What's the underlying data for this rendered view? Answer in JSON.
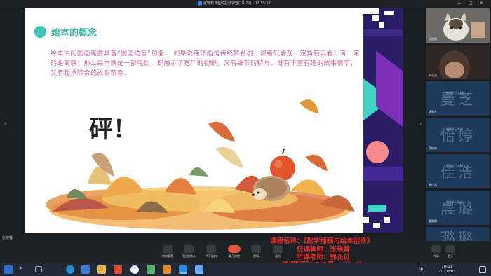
{
  "window": {
    "title": "张晓霄发起的在线课堂(18/22) | 02:19:28"
  },
  "slide": {
    "title": "绘本的概念",
    "body": "绘本中的图画需要具备“图画语言”功能， 如果说连环画是传统舞台剧，读者只能在一定角度去看，有一定的距离感；那么绘本就是一部电影，即展示了宽广的视野，又有细节的特写，既有丰富有趣的故事情节，又有起承转合的故事节奏。",
    "onomatopoeia": "砰！"
  },
  "participants": [
    {
      "name": "张晓霄",
      "type": "video-cat"
    },
    {
      "name": "郭长见",
      "type": "video-person"
    },
    {
      "name": "陈曼芝",
      "avatar_text": "曼芝",
      "mini": "摄像头已关闭"
    },
    {
      "name": "邱怡婷",
      "avatar_text": "怡婷",
      "mini": "摄像头已关闭"
    },
    {
      "name": "曾佳浩",
      "avatar_text": "佳浩",
      "mini": "摄像头已关闭"
    },
    {
      "name": "赖晨璐",
      "avatar_text": "晨璐",
      "mini": "摄像头已关闭"
    },
    {
      "name": "",
      "avatar_text": "璐璐",
      "mini": ""
    }
  ],
  "toolbar": {
    "items": [
      "取消静音",
      "开启摄像头",
      "共享窗口",
      "离开课堂",
      "邀请",
      "成员"
    ],
    "right": [
      "布局",
      "更多"
    ],
    "left_user": "张晓霄"
  },
  "caption": {
    "line1": "课程名称：《数字插画与绘本创作》",
    "line2": "任课教师：张晓霄",
    "line3": "听课老师：郭长见",
    "line4": "授课时间：3.1周一（1-4）"
  },
  "taskbar": {
    "time": "10:11",
    "date": "2021/3/1",
    "lang": "中",
    "icons": [
      "windows-icon",
      "search-icon",
      "task-view-icon",
      "edge-icon",
      "mail-icon",
      "explorer-icon",
      "app-icon",
      "chrome-icon",
      "app-icon",
      "store-icon",
      "classroom-icon",
      "app-icon"
    ]
  },
  "colors": {
    "accent_teal": "#3fc4b6",
    "body_pink": "#d8679e",
    "caption_red": "#e02b2b",
    "leave_red": "#e5533d"
  }
}
